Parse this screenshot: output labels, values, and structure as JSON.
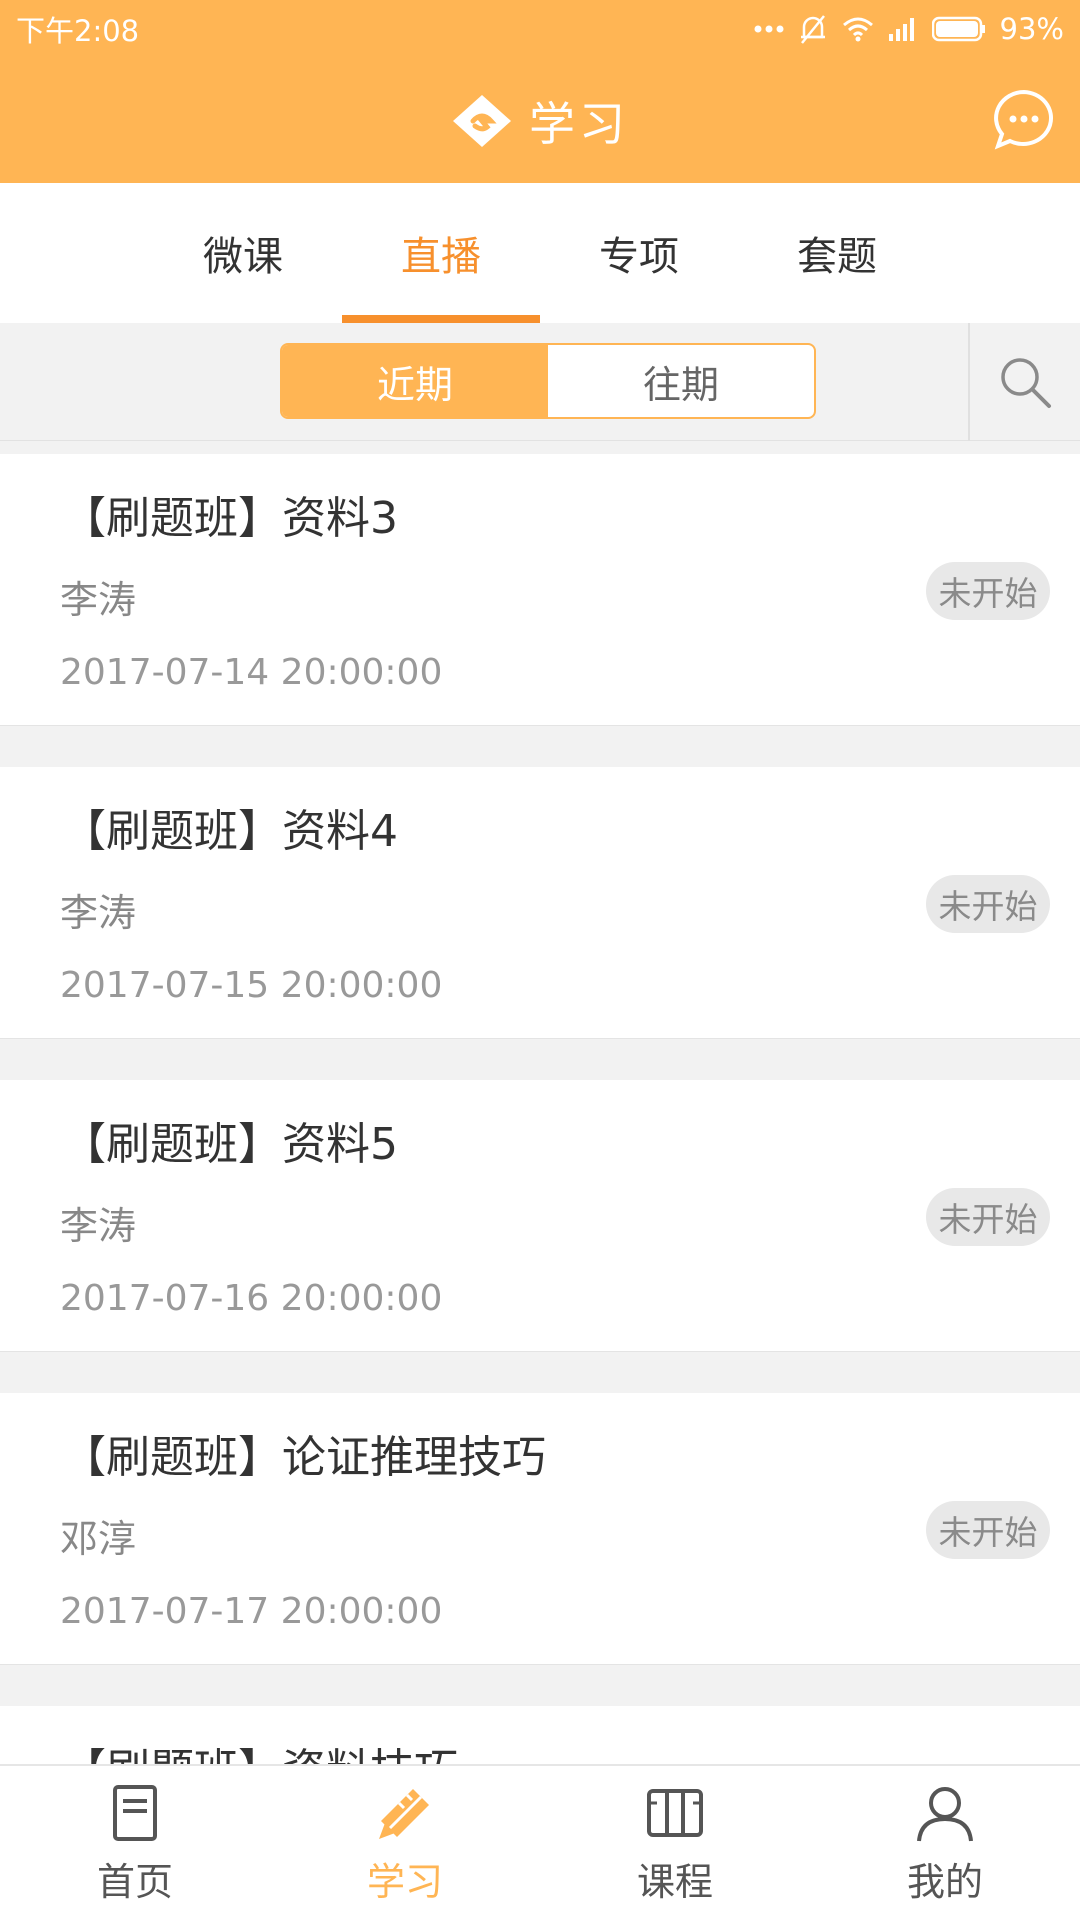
{
  "status_bar": {
    "time": "下午2:08",
    "battery": "93%"
  },
  "header": {
    "title": "学习"
  },
  "tabs": [
    {
      "label": "微课",
      "active": false
    },
    {
      "label": "直播",
      "active": true
    },
    {
      "label": "专项",
      "active": false
    },
    {
      "label": "套题",
      "active": false
    }
  ],
  "segment": {
    "items": [
      "近期",
      "往期"
    ],
    "active_index": 0
  },
  "courses": [
    {
      "title": "【刷题班】资料3",
      "teacher": "李涛",
      "time": "2017-07-14 20:00:00",
      "status": "未开始"
    },
    {
      "title": "【刷题班】资料4",
      "teacher": "李涛",
      "time": "2017-07-15 20:00:00",
      "status": "未开始"
    },
    {
      "title": "【刷题班】资料5",
      "teacher": "李涛",
      "time": "2017-07-16 20:00:00",
      "status": "未开始"
    },
    {
      "title": "【刷题班】论证推理技巧",
      "teacher": "邓淳",
      "time": "2017-07-17 20:00:00",
      "status": "未开始"
    },
    {
      "title": "【刷题班】资料技巧",
      "teacher": "",
      "time": "",
      "status": ""
    }
  ],
  "bottom_nav": [
    {
      "label": "首页",
      "icon": "document-icon",
      "active": false
    },
    {
      "label": "学习",
      "icon": "pencil-ruler-icon",
      "active": true
    },
    {
      "label": "课程",
      "icon": "book-icon",
      "active": false
    },
    {
      "label": "我的",
      "icon": "user-icon",
      "active": false
    }
  ],
  "colors": {
    "accent": "#ffb554",
    "tab_active": "#f7902d",
    "badge_bg": "#e8e8e8"
  }
}
